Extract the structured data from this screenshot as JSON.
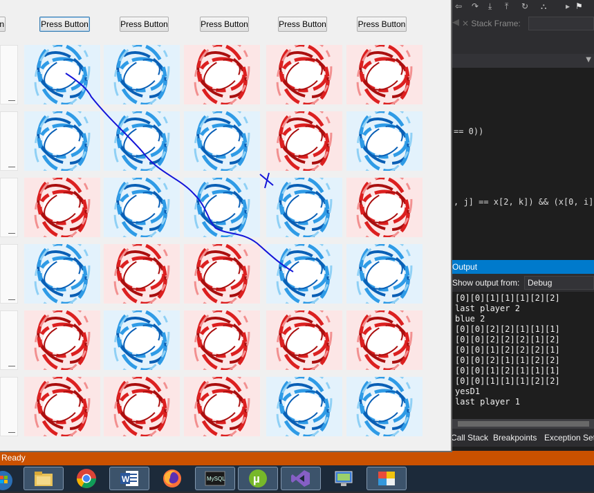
{
  "app_window": {
    "buttons": [
      {
        "label": "Press Button"
      },
      {
        "label": "Press Button"
      },
      {
        "label": "Press Button"
      },
      {
        "label": "Press Button"
      },
      {
        "label": "Press Button"
      }
    ],
    "grid": [
      [
        "blue",
        "blue",
        "red",
        "red",
        "red"
      ],
      [
        "blue",
        "blue",
        "blue",
        "red",
        "blue"
      ],
      [
        "red",
        "blue",
        "blue",
        "blue",
        "red"
      ],
      [
        "blue",
        "red",
        "red",
        "blue",
        "blue"
      ],
      [
        "red",
        "blue",
        "red",
        "red",
        "red"
      ],
      [
        "red",
        "red",
        "red",
        "blue",
        "blue"
      ]
    ],
    "colors": {
      "blue": "#1e7fd0",
      "red": "#d21c1c"
    }
  },
  "ide": {
    "toolbar": {
      "stack_frame_label": "Stack Frame:"
    },
    "code_lines": [
      "== 0))",
      ", j] == x[2, k]) && (x[0, i]"
    ],
    "output_panel": {
      "title": "Output",
      "show_output_from_label": "Show output from:",
      "show_output_from_value": "Debug",
      "lines": [
        "[0][0][1][1][1][2][2]",
        "last player 2",
        "blue 2",
        "[0][0][2][2][1][1][1]",
        "[0][0][2][2][2][1][2]",
        "[0][0][1][2][2][2][1]",
        "[0][0][2][1][1][2][2]",
        "[0][0][1][2][1][1][1]",
        "[0][0][1][1][1][2][2]",
        "yesD1",
        "last player 1"
      ]
    },
    "bottom_tabs": [
      "Call Stack",
      "Breakpoints",
      "Exception Settings"
    ],
    "status": "Ready",
    "accent_color": "#007acc",
    "status_color": "#ca5100"
  },
  "taskbar": {
    "items": [
      "file-explorer-icon",
      "chrome-icon",
      "word-icon",
      "firefox-icon",
      "mysql-icon",
      "utorrent-icon",
      "visual-studio-icon",
      "remote-desktop-icon",
      "winforms-app-icon"
    ]
  }
}
